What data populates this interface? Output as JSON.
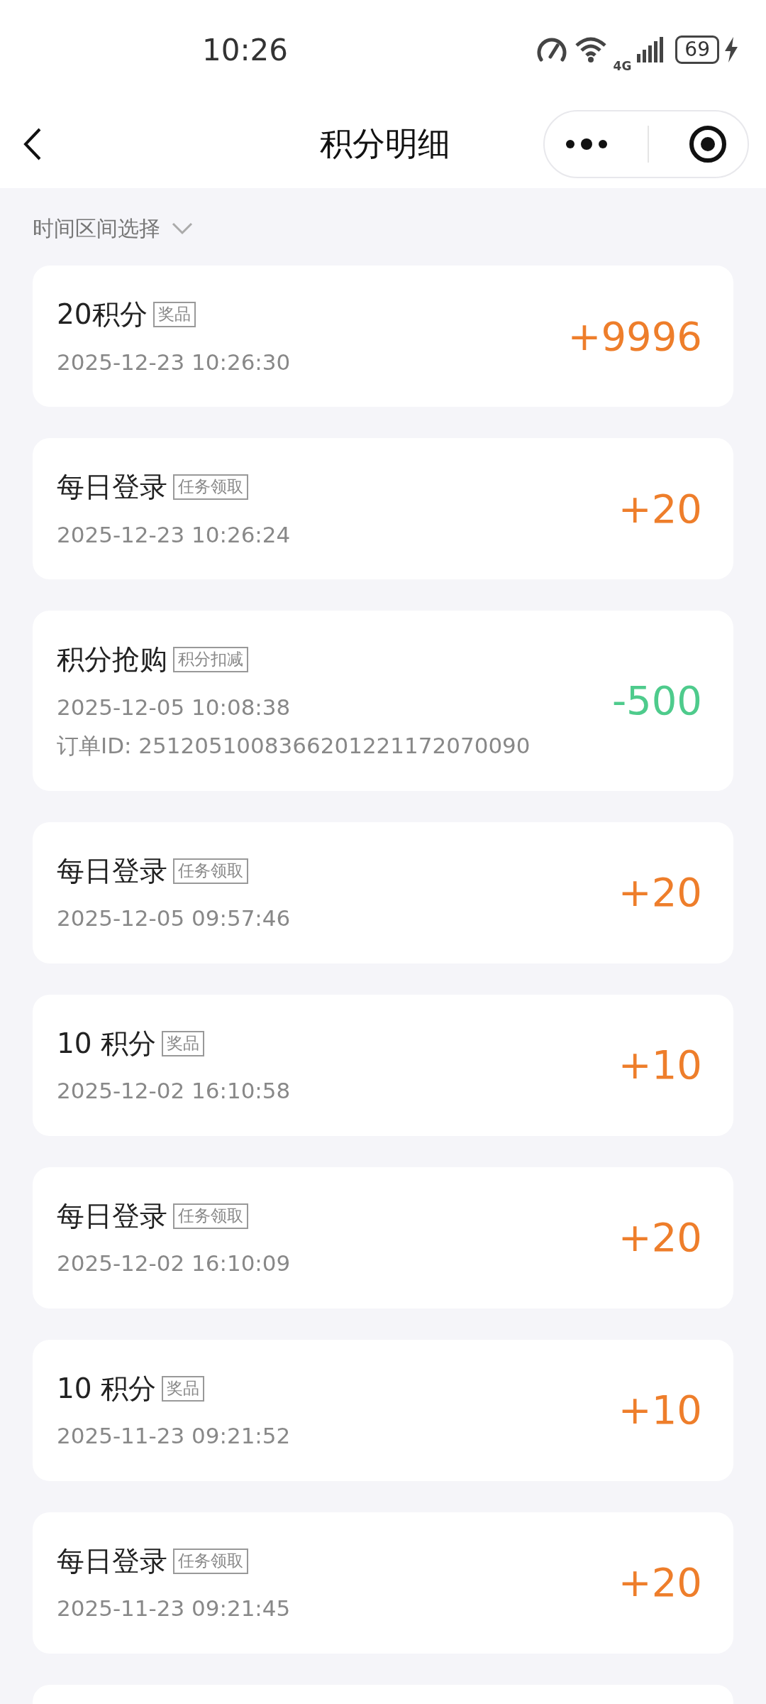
{
  "status_bar": {
    "time": "10:26",
    "network": "4G",
    "battery": "69"
  },
  "header": {
    "title": "积分明细"
  },
  "filter": {
    "label": "时间区间选择"
  },
  "records": [
    {
      "title": "20积分",
      "tag": "奖品",
      "time": "2025-12-23 10:26:30",
      "amount": "+9996",
      "kind": "income"
    },
    {
      "title": "每日登录",
      "tag": "任务领取",
      "time": "2025-12-23 10:26:24",
      "amount": "+20",
      "kind": "income"
    },
    {
      "title": "积分抢购",
      "tag": "积分扣减",
      "time": "2025-12-05 10:08:38",
      "order": "订单ID: 2512051008366201221172070090",
      "amount": "-500",
      "kind": "expense"
    },
    {
      "title": "每日登录",
      "tag": "任务领取",
      "time": "2025-12-05 09:57:46",
      "amount": "+20",
      "kind": "income"
    },
    {
      "title": "10 积分",
      "tag": "奖品",
      "time": "2025-12-02 16:10:58",
      "amount": "+10",
      "kind": "income"
    },
    {
      "title": "每日登录",
      "tag": "任务领取",
      "time": "2025-12-02 16:10:09",
      "amount": "+20",
      "kind": "income"
    },
    {
      "title": "10 积分",
      "tag": "奖品",
      "time": "2025-11-23 09:21:52",
      "amount": "+10",
      "kind": "income"
    },
    {
      "title": "每日登录",
      "tag": "任务领取",
      "time": "2025-11-23 09:21:45",
      "amount": "+20",
      "kind": "income"
    }
  ]
}
